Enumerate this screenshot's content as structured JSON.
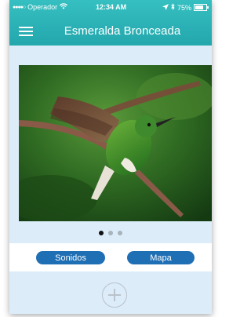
{
  "status_bar": {
    "signal_dots": "●●●●○",
    "carrier": "Operador",
    "time": "12:34 AM",
    "battery": "75%"
  },
  "header": {
    "title": "Esmeralda Bronceada",
    "menu_icon": "hamburger-menu-icon"
  },
  "gallery": {
    "image_subject": "hummingbird on branch",
    "page_count": 3,
    "current_page": 1
  },
  "actions": {
    "sounds_label": "Sonidos",
    "map_label": "Mapa",
    "add_icon": "plus-circle-icon"
  },
  "colors": {
    "header": "#2db3b6",
    "button": "#1f6fb5",
    "background": "#dcecf9"
  }
}
